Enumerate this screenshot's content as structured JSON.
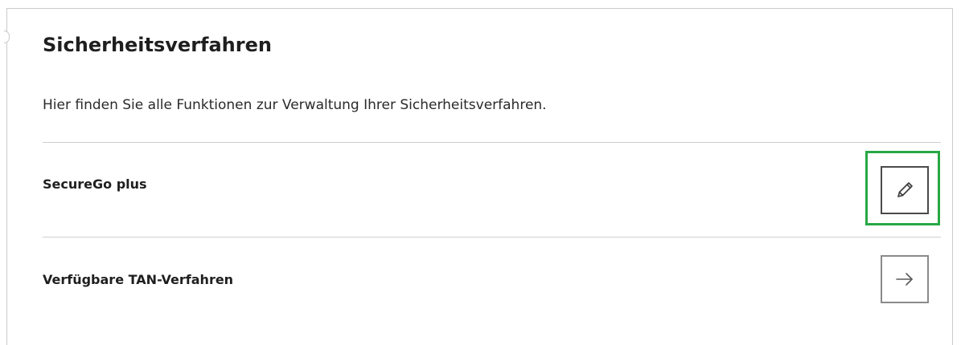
{
  "section": {
    "title": "Sicherheitsverfahren",
    "description": "Hier finden Sie alle Funktionen zur Verwaltung Ihrer Sicherheitsverfahren."
  },
  "rows": [
    {
      "label": "SecureGo plus",
      "action_icon": "pencil-icon",
      "highlighted": true
    },
    {
      "label": "Verfügbare TAN-Verfahren",
      "action_icon": "arrow-right-icon",
      "highlighted": false
    }
  ],
  "colors": {
    "highlight": "#27a844",
    "text": "#1f1f1f",
    "divider": "#cfcfcf"
  }
}
